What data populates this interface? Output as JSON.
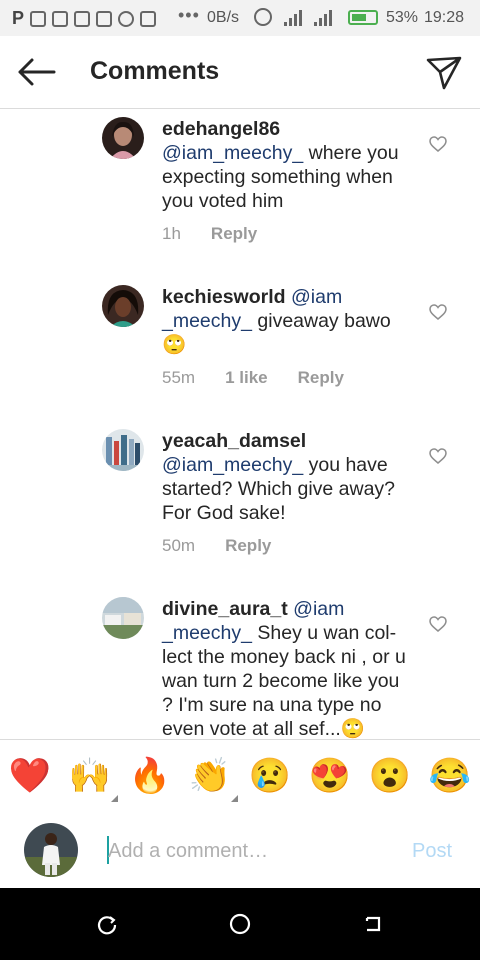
{
  "status_bar": {
    "p_glyph": "P",
    "network_speed": "0B/s",
    "battery_percent": "53%",
    "time": "19:28"
  },
  "header": {
    "back_icon": "arrow-left-icon",
    "title": "Comments",
    "send_icon": "paper-plane-icon"
  },
  "comments": [
    {
      "username": "edehangel86",
      "mention": "@iam_meechy_",
      "text": " where you expecting something when you voted him",
      "time": "1h",
      "likes": "",
      "reply_label": "Reply"
    },
    {
      "username": "kechiesworld",
      "mention": "@iam _meechy_",
      "text": " giveaway bawo 🙄",
      "time": "55m",
      "likes": "1 like",
      "reply_label": "Reply"
    },
    {
      "username": "yeacah_damsel",
      "mention": "@iam_meechy_",
      "text": " you have started? Which give away? For God sake!",
      "time": "50m",
      "likes": "",
      "reply_label": "Reply"
    },
    {
      "username": "divine_aura_t",
      "mention": "@iam _meechy_",
      "text": " Shey u wan col-lect the money back ni , or u wan turn 2 become like you ?  I'm sure na una type no even vote at all sef...🙄",
      "time": "",
      "likes": "",
      "reply_label": ""
    }
  ],
  "emoji_bar": {
    "items": [
      "❤️",
      "🙌",
      "🔥",
      "👏",
      "😢",
      "😍",
      "😮",
      "😂"
    ]
  },
  "composer": {
    "placeholder": "Add a comment…",
    "post_label": "Post"
  },
  "colors": {
    "mention": "#1f3c6e",
    "post_disabled": "#b3d9f5",
    "battery": "#4caf50"
  }
}
